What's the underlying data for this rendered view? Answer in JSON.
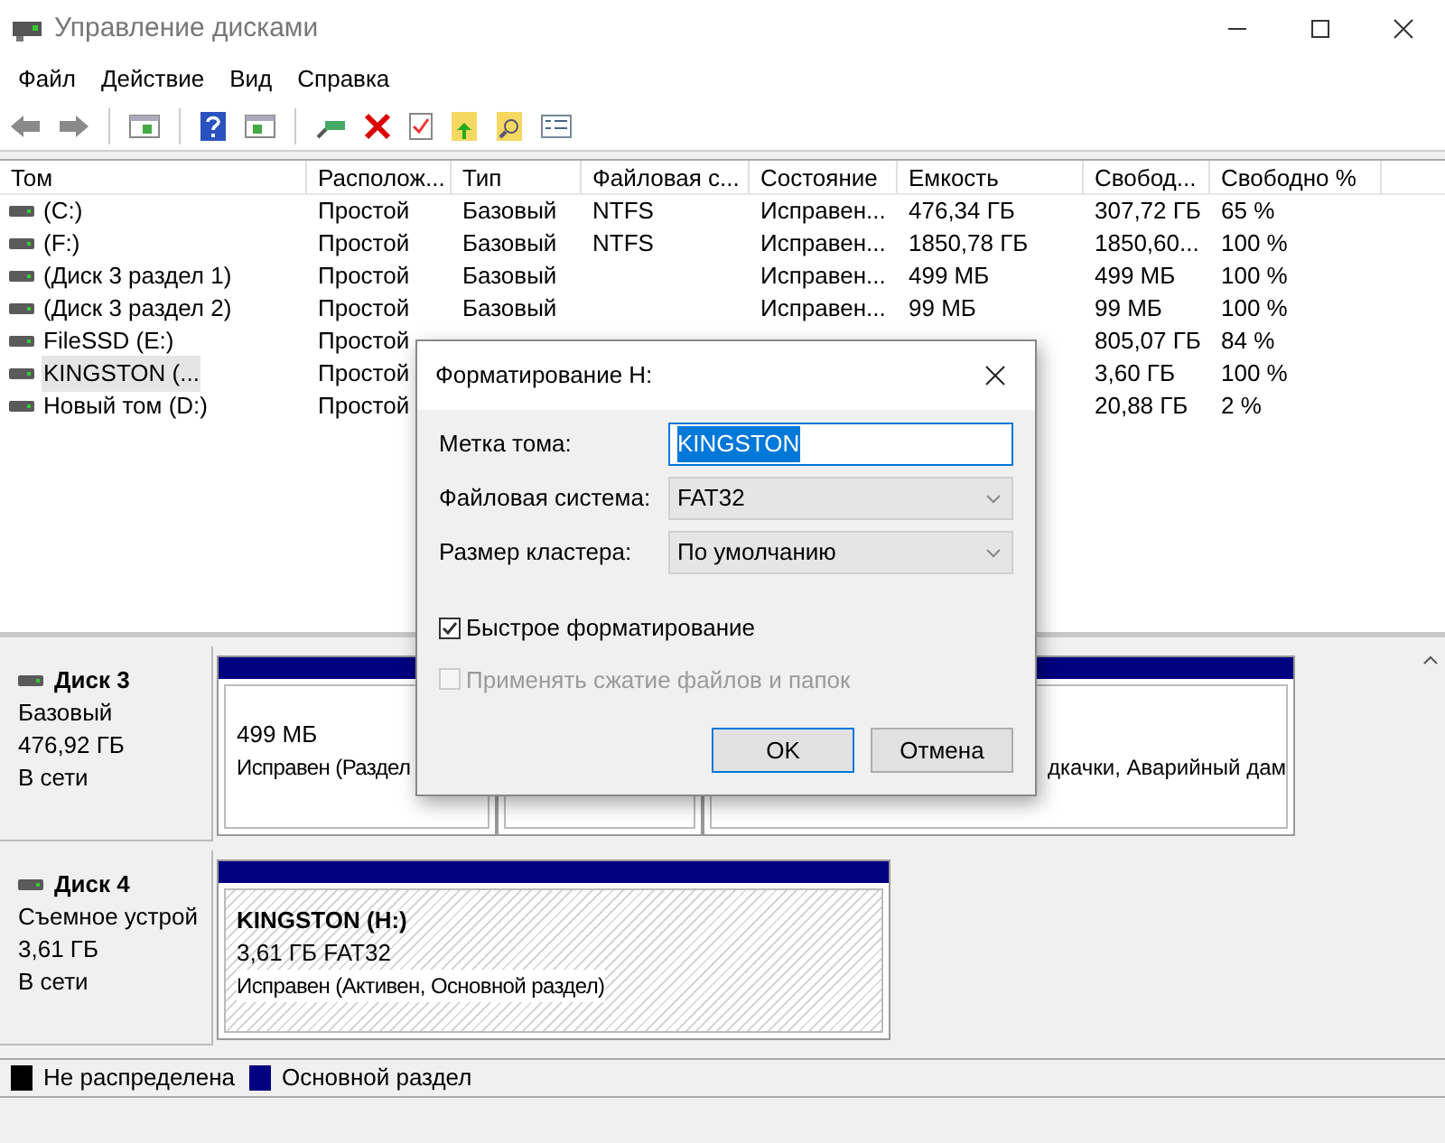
{
  "window": {
    "title": "Управление дисками"
  },
  "menu": [
    "Файл",
    "Действие",
    "Вид",
    "Справка"
  ],
  "table": {
    "columns": [
      "Том",
      "Располож...",
      "Тип",
      "Файловая с...",
      "Состояние",
      "Емкость",
      "Свобод...",
      "Свободно %"
    ],
    "rows": [
      {
        "selected": false,
        "volume": "(C:)",
        "layout": "Простой",
        "type": "Базовый",
        "fs": "NTFS",
        "status": "Исправен...",
        "capacity": "476,34 ГБ",
        "free": "307,72 ГБ",
        "free_pct": "65 %"
      },
      {
        "selected": false,
        "volume": "(F:)",
        "layout": "Простой",
        "type": "Базовый",
        "fs": "NTFS",
        "status": "Исправен...",
        "capacity": "1850,78 ГБ",
        "free": "1850,60...",
        "free_pct": "100 %"
      },
      {
        "selected": false,
        "volume": "(Диск 3 раздел 1)",
        "layout": "Простой",
        "type": "Базовый",
        "status": "Исправен...",
        "capacity": "499 МБ",
        "free": "499 МБ",
        "free_pct": "100 %"
      },
      {
        "selected": false,
        "volume": "(Диск 3 раздел 2)",
        "layout": "Простой",
        "type": "Базовый",
        "status": "Исправен...",
        "capacity": "99 МБ",
        "free": "99 МБ",
        "free_pct": "100 %"
      },
      {
        "selected": false,
        "volume": "FileSSD (E:)",
        "layout": "Простой",
        "free": "805,07 ГБ",
        "free_pct": "84 %"
      },
      {
        "selected": true,
        "volume": "KINGSTON (...",
        "layout": "Простой",
        "free": "3,60 ГБ",
        "free_pct": "100 %"
      },
      {
        "selected": false,
        "volume": "Новый том (D:)",
        "layout": "Простой",
        "free": "20,88 ГБ",
        "free_pct": "2 %"
      }
    ]
  },
  "disks": [
    {
      "name": "Диск 3",
      "type": "Базовый",
      "size": "476,92 ГБ",
      "status": "В сети",
      "partitions": [
        {
          "selected": false,
          "size": "499 МБ",
          "status": "Исправен (Раздел"
        },
        {
          "selected": false
        },
        {
          "selected": false,
          "status": "дкачки, Аварийный дам"
        }
      ]
    },
    {
      "name": "Диск 4",
      "type": "Съемное устрой",
      "size": "3,61 ГБ",
      "status": "В сети",
      "partitions": [
        {
          "selected": true,
          "label": "KINGSTON  (H:)",
          "size": "3,61 ГБ FAT32",
          "status": "Исправен (Активен, Основной раздел)"
        }
      ]
    }
  ],
  "legend": [
    {
      "label": "Не распределена",
      "color": "#000000"
    },
    {
      "label": "Основной раздел",
      "color": "#000080"
    }
  ],
  "dialog": {
    "title": "Форматирование H:",
    "fields": [
      {
        "kind": "text",
        "label": "Метка тома:",
        "value": "KINGSTON",
        "selected": true
      },
      {
        "kind": "select",
        "label": "Файловая система:",
        "value": "FAT32"
      },
      {
        "kind": "select",
        "label": "Размер кластера:",
        "value": "По умолчанию"
      }
    ],
    "checkboxes": [
      {
        "label": "Быстрое форматирование",
        "checked": true,
        "disabled": false
      },
      {
        "label": "Применять сжатие файлов и папок",
        "checked": false,
        "disabled": true
      }
    ],
    "buttons": [
      {
        "label": "OK",
        "default": true
      },
      {
        "label": "Отмена",
        "default": false
      }
    ]
  }
}
